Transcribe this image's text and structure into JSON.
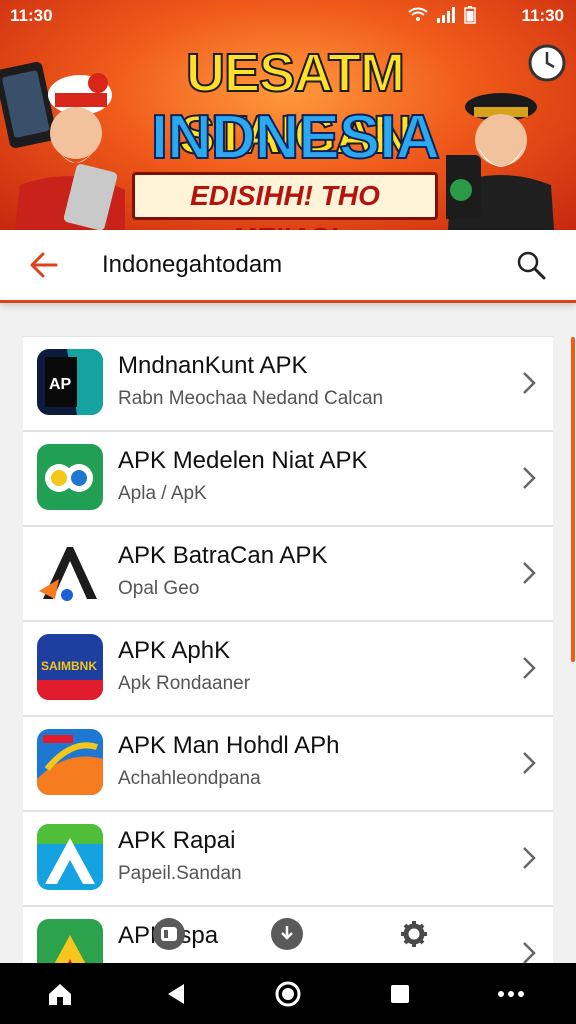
{
  "status_bar": {
    "time_left": "11:30",
    "time_right": "11:30"
  },
  "banner": {
    "line1": "UESATM STAIGAN",
    "line2": "INDNESIA",
    "ribbon": "EDISIHH! THO MEIIAS!"
  },
  "search": {
    "query": "Indonegahtodam",
    "back_icon": "back-arrow-icon",
    "search_icon": "search-icon"
  },
  "apps": [
    {
      "title": "MndnanKunt APK",
      "subtitle": "Rabn Meochaa Nedand Calcan",
      "icon_colors": [
        "#0d1b3e",
        "#14a3a0"
      ]
    },
    {
      "title": "APK Medelen Niat APK",
      "subtitle": "Apla / ApK",
      "icon_colors": [
        "#21a055",
        "#f5c71a"
      ]
    },
    {
      "title": "APK BatraCan APK",
      "subtitle": "Opal Geo",
      "icon_colors": [
        "#ffffff",
        "#1c1c1c"
      ]
    },
    {
      "title": "APK AphK",
      "subtitle": "Apk Rondaaner",
      "icon_colors": [
        "#1d3fa0",
        "#e21b2d"
      ]
    },
    {
      "title": "APK Man Hohdl APh",
      "subtitle": "Achahleondpana",
      "icon_colors": [
        "#1d78d4",
        "#f57c1f"
      ]
    },
    {
      "title": "APK Rapai",
      "subtitle": "Papeil.Sandan",
      "icon_colors": [
        "#14a3e0",
        "#4fbf3a"
      ]
    },
    {
      "title": "APK Ispa",
      "subtitle": "",
      "icon_colors": [
        "#2ca24c",
        "#f7c51c"
      ]
    }
  ],
  "accent_color": "#f05a1a",
  "nav": [
    "home-icon",
    "back-icon",
    "home-circle-icon",
    "recents-icon",
    "more-icon"
  ]
}
